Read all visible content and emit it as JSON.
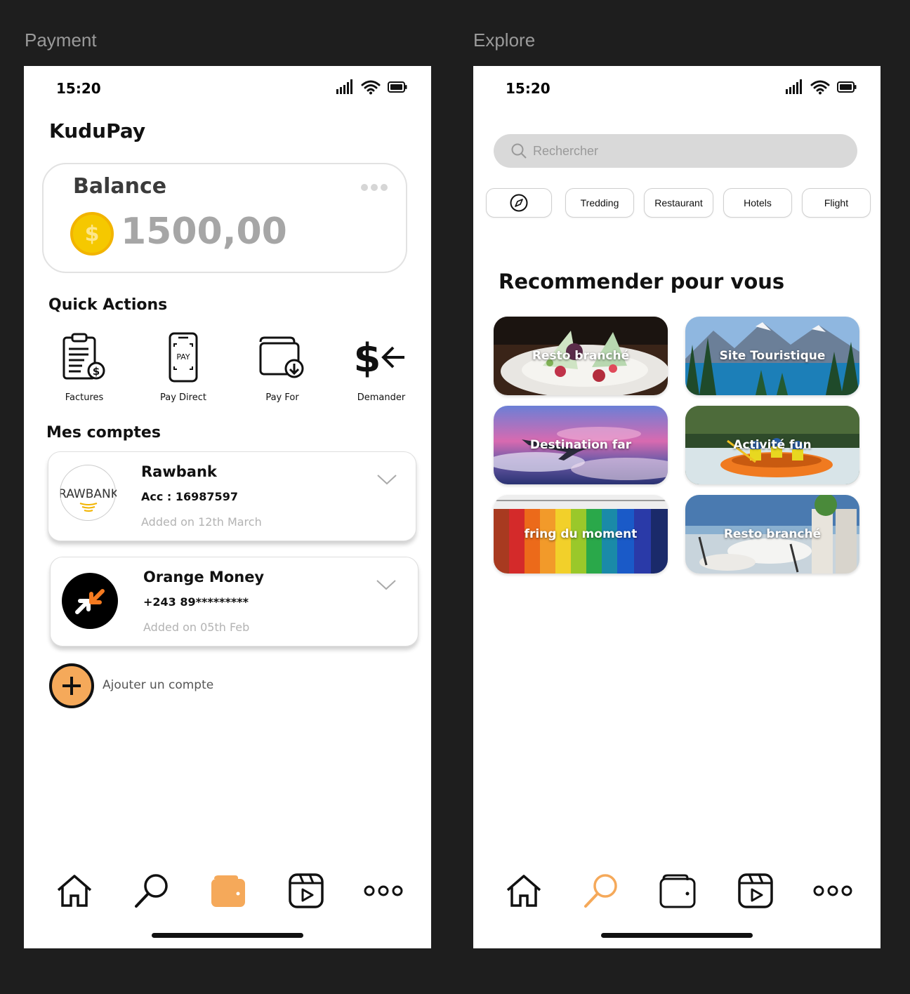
{
  "frames": {
    "payment_label": "Payment",
    "explore_label": "Explore"
  },
  "payment": {
    "status_time": "15:20",
    "app_title": "KuduPay",
    "balance": {
      "label": "Balance",
      "value": "1500,00",
      "coin_symbol": "$"
    },
    "quick_actions_title": "Quick Actions",
    "quick_actions": [
      {
        "label": "Factures",
        "icon": "invoice-icon"
      },
      {
        "label": "Pay Direct",
        "icon": "phone-pay-icon",
        "icon_text": "PAY"
      },
      {
        "label": "Pay For",
        "icon": "wallet-download-icon"
      },
      {
        "label": "Demander",
        "icon": "request-money-icon"
      }
    ],
    "accounts_title": "Mes comptes",
    "accounts": [
      {
        "name": "Rawbank",
        "number": "Acc : 16987597",
        "added": "Added on 12th March",
        "logo_text": "RAWBANK"
      },
      {
        "name": "Orange Money",
        "number": "+243 89*********",
        "added": "Added on 05th Feb"
      }
    ],
    "add_account_label": "Ajouter un compte",
    "nav": [
      "home",
      "search",
      "wallet",
      "reels",
      "more"
    ],
    "nav_active": "wallet"
  },
  "explore": {
    "status_time": "15:20",
    "search_placeholder": "Rechercher",
    "chips": [
      "Tredding",
      "Restaurant",
      "Hotels",
      "Flight"
    ],
    "recommend_title": "Recommender pour vous",
    "tiles": [
      {
        "label": "Resto branché",
        "image": "food-dish"
      },
      {
        "label": "Site Touristique",
        "image": "mountain-lake"
      },
      {
        "label": "Destination far",
        "image": "airplane-sunset"
      },
      {
        "label": "Activité fun",
        "image": "rafting"
      },
      {
        "label": "fring du moment",
        "image": "clothes-rack"
      },
      {
        "label": "Resto branché",
        "image": "terrace-restaurant"
      }
    ],
    "nav_active": "search"
  },
  "colors": {
    "accent": "#f5a95a",
    "coin": "#f5c800",
    "balance_text": "#a6a6a6",
    "search_bg": "#d9d9d9"
  }
}
